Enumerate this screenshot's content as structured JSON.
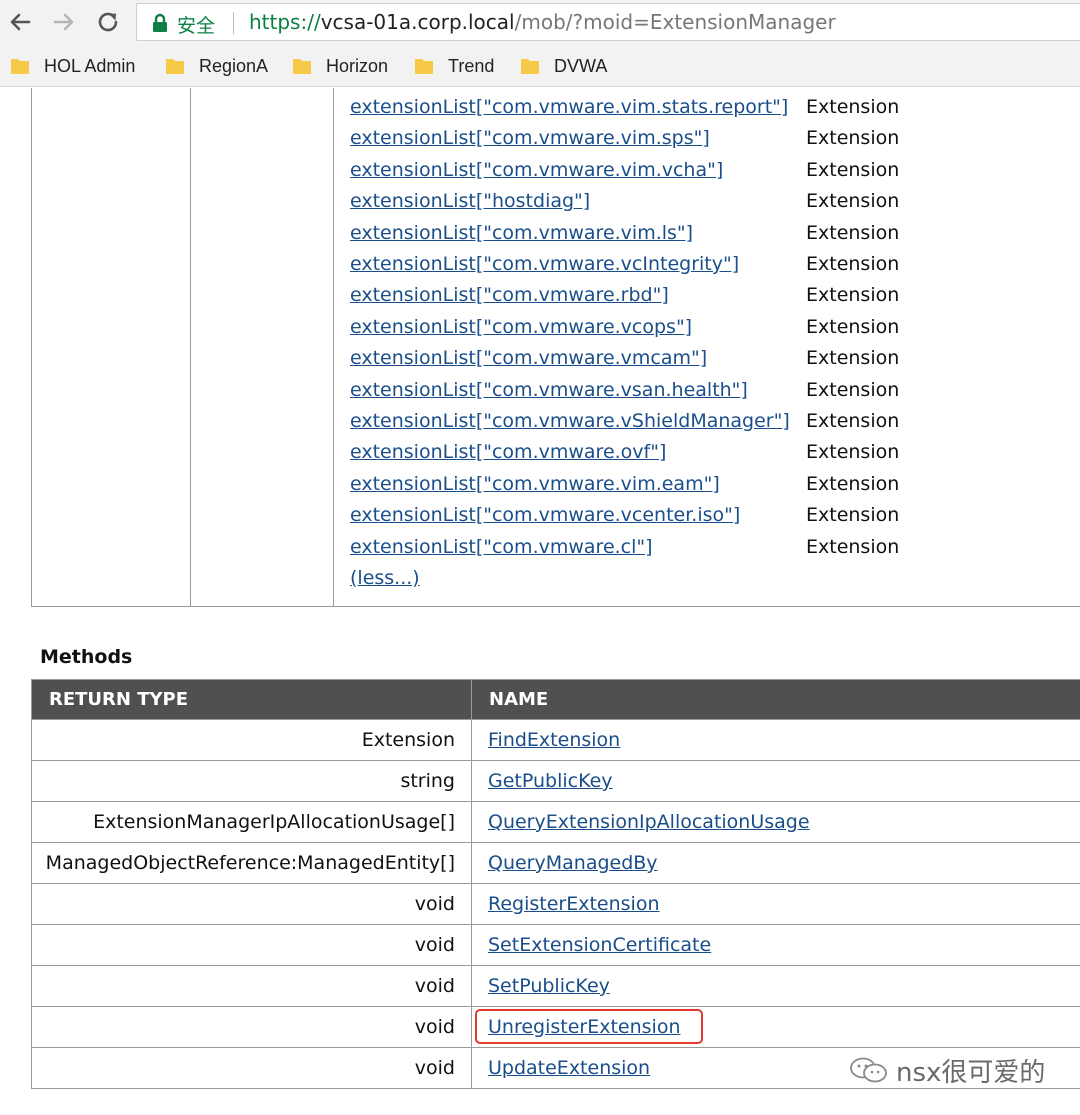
{
  "browser": {
    "security_label": "安全",
    "url_scheme": "https://",
    "url_host": "vcsa-01a.corp.local",
    "url_path": "/mob/?moid=ExtensionManager",
    "nav_icons": [
      "back-arrow-icon",
      "forward-arrow-icon",
      "reload-icon"
    ],
    "bookmarks": [
      {
        "label": "HOL Admin",
        "icon": "folder-icon"
      },
      {
        "label": "RegionA",
        "icon": "folder-icon"
      },
      {
        "label": "Horizon",
        "icon": "folder-icon"
      },
      {
        "label": "Trend",
        "icon": "folder-icon"
      },
      {
        "label": "DVWA",
        "icon": "folder-icon"
      }
    ],
    "folder_color": "#f7c948"
  },
  "extensions": {
    "items": [
      {
        "name": "extensionList[\"com.vmware.vim.stats.report\"]",
        "type": "Extension"
      },
      {
        "name": "extensionList[\"com.vmware.vim.sps\"]",
        "type": "Extension"
      },
      {
        "name": "extensionList[\"com.vmware.vim.vcha\"]",
        "type": "Extension"
      },
      {
        "name": "extensionList[\"hostdiag\"]",
        "type": "Extension"
      },
      {
        "name": "extensionList[\"com.vmware.vim.ls\"]",
        "type": "Extension"
      },
      {
        "name": "extensionList[\"com.vmware.vcIntegrity\"]",
        "type": "Extension"
      },
      {
        "name": "extensionList[\"com.vmware.rbd\"]",
        "type": "Extension"
      },
      {
        "name": "extensionList[\"com.vmware.vcops\"]",
        "type": "Extension"
      },
      {
        "name": "extensionList[\"com.vmware.vmcam\"]",
        "type": "Extension"
      },
      {
        "name": "extensionList[\"com.vmware.vsan.health\"]",
        "type": "Extension"
      },
      {
        "name": "extensionList[\"com.vmware.vShieldManager\"]",
        "type": "Extension"
      },
      {
        "name": "extensionList[\"com.vmware.ovf\"]",
        "type": "Extension"
      },
      {
        "name": "extensionList[\"com.vmware.vim.eam\"]",
        "type": "Extension"
      },
      {
        "name": "extensionList[\"com.vmware.vcenter.iso\"]",
        "type": "Extension"
      },
      {
        "name": "extensionList[\"com.vmware.cl\"]",
        "type": "Extension"
      }
    ],
    "less_link": "(less...)"
  },
  "methods": {
    "title": "Methods",
    "headers": {
      "return_type": "RETURN TYPE",
      "name": "NAME"
    },
    "rows": [
      {
        "return_type": "Extension",
        "name": "FindExtension",
        "highlighted": false
      },
      {
        "return_type": "string",
        "name": "GetPublicKey",
        "highlighted": false
      },
      {
        "return_type": "ExtensionManagerIpAllocationUsage[]",
        "name": "QueryExtensionIpAllocationUsage",
        "highlighted": false
      },
      {
        "return_type": "ManagedObjectReference:ManagedEntity[]",
        "name": "QueryManagedBy",
        "highlighted": false
      },
      {
        "return_type": "void",
        "name": "RegisterExtension",
        "highlighted": false
      },
      {
        "return_type": "void",
        "name": "SetExtensionCertificate",
        "highlighted": false
      },
      {
        "return_type": "void",
        "name": "SetPublicKey",
        "highlighted": false
      },
      {
        "return_type": "void",
        "name": "UnregisterExtension",
        "highlighted": true
      },
      {
        "return_type": "void",
        "name": "UpdateExtension",
        "highlighted": false
      }
    ],
    "highlight_color": "#e33b2e",
    "header_bg": "#505050",
    "link_color": "#1a4e8a"
  },
  "watermark": {
    "text": "nsx很可爱的",
    "icon": "wechat-icon"
  }
}
